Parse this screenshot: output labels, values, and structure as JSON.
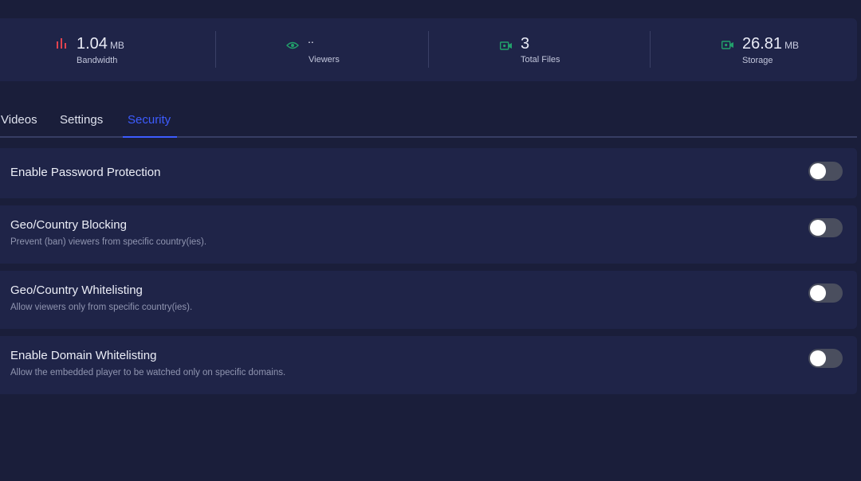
{
  "stats": [
    {
      "icon": "bar-chart-icon",
      "value": "1.04",
      "unit": "MB",
      "label": "Bandwidth",
      "color": "#e0434f"
    },
    {
      "icon": "eye-icon",
      "value": "..",
      "unit": "",
      "label": "Viewers",
      "color": "#22a06b"
    },
    {
      "icon": "video-camera-icon",
      "value": "3",
      "unit": "",
      "label": "Total Files",
      "color": "#22a06b"
    },
    {
      "icon": "video-camera-icon",
      "value": "26.81",
      "unit": "MB",
      "label": "Storage",
      "color": "#22a06b"
    }
  ],
  "tabs": [
    {
      "label": "Videos",
      "active": false
    },
    {
      "label": "Settings",
      "active": false
    },
    {
      "label": "Security",
      "active": true
    }
  ],
  "settings": [
    {
      "title": "Enable Password Protection",
      "description": "",
      "enabled": false
    },
    {
      "title": "Geo/Country Blocking",
      "description": "Prevent (ban) viewers from specific country(ies).",
      "enabled": false
    },
    {
      "title": "Geo/Country Whitelisting",
      "description": "Allow viewers only from specific country(ies).",
      "enabled": false
    },
    {
      "title": "Enable Domain Whitelisting",
      "description": "Allow the embedded player to be watched only on specific domains.",
      "enabled": false
    }
  ],
  "colors": {
    "background": "#1a1e3a",
    "card": "#1f2448",
    "accent": "#3d5cff",
    "toggle_off": "#4a4e5e"
  }
}
